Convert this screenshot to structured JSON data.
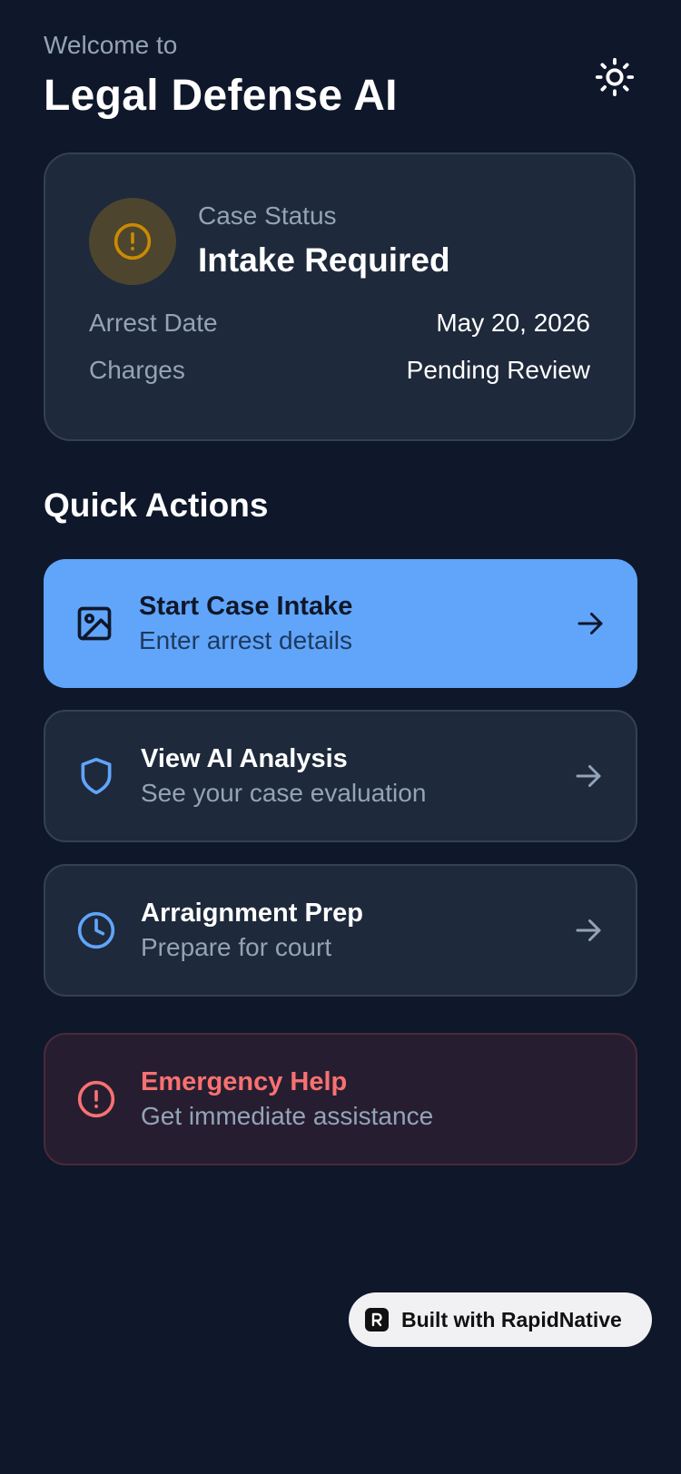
{
  "header": {
    "welcome": "Welcome to",
    "title": "Legal Defense AI",
    "theme_icon": "sun-icon"
  },
  "status_card": {
    "icon": "alert-circle-icon",
    "label": "Case Status",
    "value": "Intake Required",
    "rows": [
      {
        "label": "Arrest Date",
        "value": "May 20, 2026"
      },
      {
        "label": "Charges",
        "value": "Pending Review"
      }
    ]
  },
  "quick_actions": {
    "title": "Quick Actions",
    "items": [
      {
        "title": "Start Case Intake",
        "subtitle": "Enter arrest details",
        "icon": "image-icon",
        "accent": "#60a5fa"
      },
      {
        "title": "View AI Analysis",
        "subtitle": "See your case evaluation",
        "icon": "shield-icon",
        "accent": "#60a5fa"
      },
      {
        "title": "Arraignment Prep",
        "subtitle": "Prepare for court",
        "icon": "clock-icon",
        "accent": "#60a5fa"
      },
      {
        "title": "Emergency Help",
        "subtitle": "Get immediate assistance",
        "icon": "alert-circle-icon",
        "accent": "#f87171"
      }
    ]
  },
  "badge": {
    "text": "Built with RapidNative",
    "icon": "rapidnative-logo-icon"
  },
  "colors": {
    "background": "#0f172a",
    "card": "#1e293b",
    "primary": "#60a5fa",
    "warning": "#ca8a04",
    "danger": "#f87171"
  }
}
